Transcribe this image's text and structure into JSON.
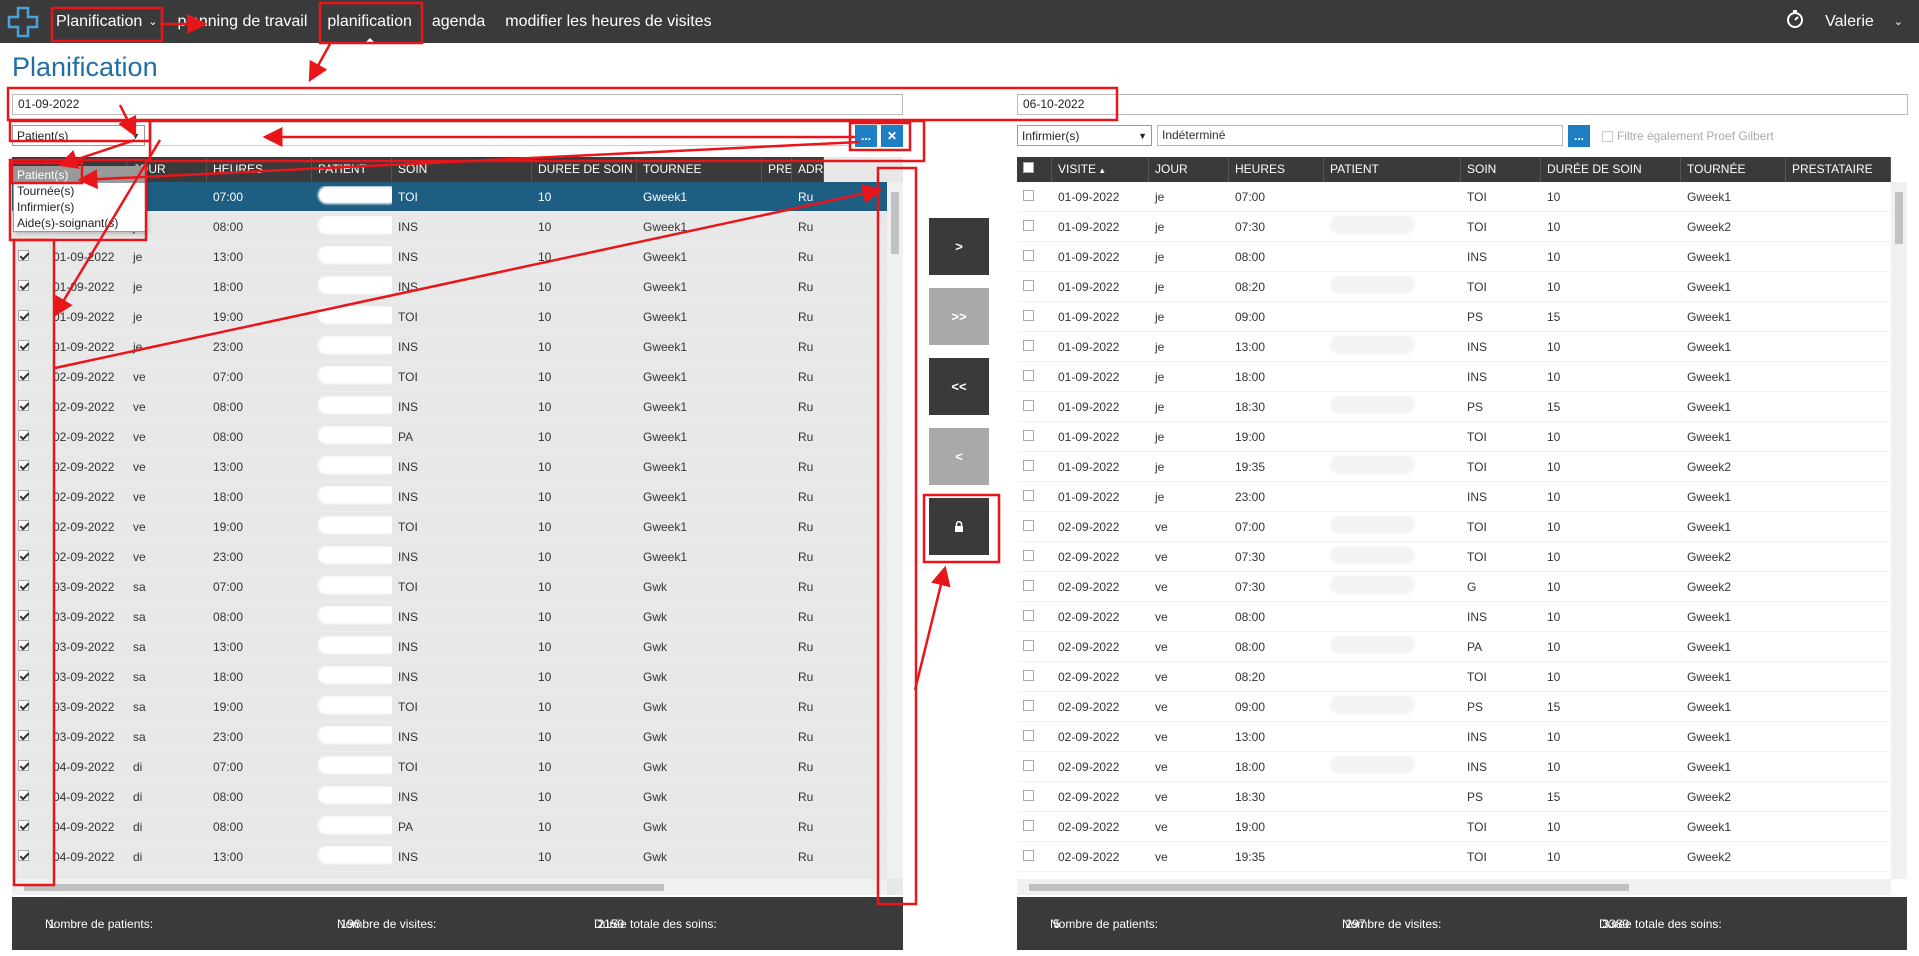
{
  "nav": {
    "items": [
      {
        "label": "Planification",
        "has_chevron": true
      },
      {
        "label": "planning de travail"
      },
      {
        "label": "planification",
        "active": true
      },
      {
        "label": "agenda"
      },
      {
        "label": "modifier les heures de visites"
      }
    ],
    "user": "Valerie",
    "timer_icon": "stopwatch-icon"
  },
  "page_title": "Planification",
  "date_from": "01-09-2022",
  "date_to": "06-10-2022",
  "left_panel": {
    "selector_value": "Patient(s)",
    "dropdown_options": [
      "Patient(s)",
      "Tournée(s)",
      "Infirmier(s)",
      "Aide(s)-soignant(s)"
    ],
    "browse_label": "...",
    "clear_label": "✕",
    "columns": [
      "JOUR",
      "HEURES",
      "PATIENT",
      "SOIN",
      "DUREE DE SOIN",
      "TOURNEE",
      "PRESTATAIRE",
      "ADR"
    ],
    "rows": [
      {
        "date": "01-09-2022",
        "jour": "je",
        "heure": "07:00",
        "soin": "TOI",
        "duree": "10",
        "tournee": "Gweek1",
        "adr": "Ru",
        "selected": true
      },
      {
        "date": "01-09-2022",
        "jour": "je",
        "heure": "08:00",
        "soin": "INS",
        "duree": "10",
        "tournee": "Gweek1",
        "adr": "Ru"
      },
      {
        "date": "01-09-2022",
        "jour": "je",
        "heure": "13:00",
        "soin": "INS",
        "duree": "10",
        "tournee": "Gweek1",
        "adr": "Ru"
      },
      {
        "date": "01-09-2022",
        "jour": "je",
        "heure": "18:00",
        "soin": "INS",
        "duree": "10",
        "tournee": "Gweek1",
        "adr": "Ru"
      },
      {
        "date": "01-09-2022",
        "jour": "je",
        "heure": "19:00",
        "soin": "TOI",
        "duree": "10",
        "tournee": "Gweek1",
        "adr": "Ru"
      },
      {
        "date": "01-09-2022",
        "jour": "je",
        "heure": "23:00",
        "soin": "INS",
        "duree": "10",
        "tournee": "Gweek1",
        "adr": "Ru"
      },
      {
        "date": "02-09-2022",
        "jour": "ve",
        "heure": "07:00",
        "soin": "TOI",
        "duree": "10",
        "tournee": "Gweek1",
        "adr": "Ru"
      },
      {
        "date": "02-09-2022",
        "jour": "ve",
        "heure": "08:00",
        "soin": "INS",
        "duree": "10",
        "tournee": "Gweek1",
        "adr": "Ru"
      },
      {
        "date": "02-09-2022",
        "jour": "ve",
        "heure": "08:00",
        "soin": "PA",
        "duree": "10",
        "tournee": "Gweek1",
        "adr": "Ru"
      },
      {
        "date": "02-09-2022",
        "jour": "ve",
        "heure": "13:00",
        "soin": "INS",
        "duree": "10",
        "tournee": "Gweek1",
        "adr": "Ru"
      },
      {
        "date": "02-09-2022",
        "jour": "ve",
        "heure": "18:00",
        "soin": "INS",
        "duree": "10",
        "tournee": "Gweek1",
        "adr": "Ru"
      },
      {
        "date": "02-09-2022",
        "jour": "ve",
        "heure": "19:00",
        "soin": "TOI",
        "duree": "10",
        "tournee": "Gweek1",
        "adr": "Ru"
      },
      {
        "date": "02-09-2022",
        "jour": "ve",
        "heure": "23:00",
        "soin": "INS",
        "duree": "10",
        "tournee": "Gweek1",
        "adr": "Ru"
      },
      {
        "date": "03-09-2022",
        "jour": "sa",
        "heure": "07:00",
        "soin": "TOI",
        "duree": "10",
        "tournee": "Gwk",
        "adr": "Ru"
      },
      {
        "date": "03-09-2022",
        "jour": "sa",
        "heure": "08:00",
        "soin": "INS",
        "duree": "10",
        "tournee": "Gwk",
        "adr": "Ru"
      },
      {
        "date": "03-09-2022",
        "jour": "sa",
        "heure": "13:00",
        "soin": "INS",
        "duree": "10",
        "tournee": "Gwk",
        "adr": "Ru"
      },
      {
        "date": "03-09-2022",
        "jour": "sa",
        "heure": "18:00",
        "soin": "INS",
        "duree": "10",
        "tournee": "Gwk",
        "adr": "Ru"
      },
      {
        "date": "03-09-2022",
        "jour": "sa",
        "heure": "19:00",
        "soin": "TOI",
        "duree": "10",
        "tournee": "Gwk",
        "adr": "Ru"
      },
      {
        "date": "03-09-2022",
        "jour": "sa",
        "heure": "23:00",
        "soin": "INS",
        "duree": "10",
        "tournee": "Gwk",
        "adr": "Ru"
      },
      {
        "date": "04-09-2022",
        "jour": "di",
        "heure": "07:00",
        "soin": "TOI",
        "duree": "10",
        "tournee": "Gwk",
        "adr": "Ru"
      },
      {
        "date": "04-09-2022",
        "jour": "di",
        "heure": "08:00",
        "soin": "INS",
        "duree": "10",
        "tournee": "Gwk",
        "adr": "Ru"
      },
      {
        "date": "04-09-2022",
        "jour": "di",
        "heure": "08:00",
        "soin": "PA",
        "duree": "10",
        "tournee": "Gwk",
        "adr": "Ru"
      },
      {
        "date": "04-09-2022",
        "jour": "di",
        "heure": "13:00",
        "soin": "INS",
        "duree": "10",
        "tournee": "Gwk",
        "adr": "Ru"
      }
    ],
    "footer": {
      "patients_label": "Nombre de patients:",
      "patients_value": "1",
      "visits_label": "Nombre de visites:",
      "visits_value": "196",
      "duration_label": "Durée totale des soins:",
      "duration_value": "2150"
    }
  },
  "middle_buttons": [
    {
      "label": ">",
      "style": "dark"
    },
    {
      "label": ">>",
      "style": "light"
    },
    {
      "label": "<<",
      "style": "dark"
    },
    {
      "label": "<",
      "style": "light"
    },
    {
      "label": "lock-icon",
      "style": "dark"
    }
  ],
  "right_panel": {
    "selector_value": "Infirmier(s)",
    "input_value": "Indéterminé",
    "browse_label": "...",
    "filter_label": "Filtre également Proef Gilbert",
    "columns": [
      "VISITE",
      "JOUR",
      "HEURES",
      "PATIENT",
      "SOIN",
      "DURÉE DE SOIN",
      "TOURNÉE",
      "PRESTATAIRE"
    ],
    "rows": [
      {
        "date": "01-09-2022",
        "jour": "je",
        "heure": "07:00",
        "blur": false,
        "soin": "TOI",
        "duree": "10",
        "tournee": "Gweek1"
      },
      {
        "date": "01-09-2022",
        "jour": "je",
        "heure": "07:30",
        "blur": true,
        "soin": "TOI",
        "duree": "10",
        "tournee": "Gweek2"
      },
      {
        "date": "01-09-2022",
        "jour": "je",
        "heure": "08:00",
        "blur": false,
        "soin": "INS",
        "duree": "10",
        "tournee": "Gweek1"
      },
      {
        "date": "01-09-2022",
        "jour": "je",
        "heure": "08:20",
        "blur": true,
        "soin": "TOI",
        "duree": "10",
        "tournee": "Gweek1"
      },
      {
        "date": "01-09-2022",
        "jour": "je",
        "heure": "09:00",
        "blur": false,
        "soin": "PS",
        "duree": "15",
        "tournee": "Gweek1"
      },
      {
        "date": "01-09-2022",
        "jour": "je",
        "heure": "13:00",
        "blur": true,
        "soin": "INS",
        "duree": "10",
        "tournee": "Gweek1"
      },
      {
        "date": "01-09-2022",
        "jour": "je",
        "heure": "18:00",
        "blur": false,
        "soin": "INS",
        "duree": "10",
        "tournee": "Gweek1"
      },
      {
        "date": "01-09-2022",
        "jour": "je",
        "heure": "18:30",
        "blur": true,
        "soin": "PS",
        "duree": "15",
        "tournee": "Gweek1"
      },
      {
        "date": "01-09-2022",
        "jour": "je",
        "heure": "19:00",
        "blur": false,
        "soin": "TOI",
        "duree": "10",
        "tournee": "Gweek1"
      },
      {
        "date": "01-09-2022",
        "jour": "je",
        "heure": "19:35",
        "blur": true,
        "soin": "TOI",
        "duree": "10",
        "tournee": "Gweek2"
      },
      {
        "date": "01-09-2022",
        "jour": "je",
        "heure": "23:00",
        "blur": false,
        "soin": "INS",
        "duree": "10",
        "tournee": "Gweek1"
      },
      {
        "date": "02-09-2022",
        "jour": "ve",
        "heure": "07:00",
        "blur": true,
        "soin": "TOI",
        "duree": "10",
        "tournee": "Gweek1"
      },
      {
        "date": "02-09-2022",
        "jour": "ve",
        "heure": "07:30",
        "blur": true,
        "soin": "TOI",
        "duree": "10",
        "tournee": "Gweek2"
      },
      {
        "date": "02-09-2022",
        "jour": "ve",
        "heure": "07:30",
        "blur": true,
        "soin": "G",
        "duree": "10",
        "tournee": "Gweek2"
      },
      {
        "date": "02-09-2022",
        "jour": "ve",
        "heure": "08:00",
        "blur": false,
        "soin": "INS",
        "duree": "10",
        "tournee": "Gweek1"
      },
      {
        "date": "02-09-2022",
        "jour": "ve",
        "heure": "08:00",
        "blur": true,
        "soin": "PA",
        "duree": "10",
        "tournee": "Gweek1"
      },
      {
        "date": "02-09-2022",
        "jour": "ve",
        "heure": "08:20",
        "blur": false,
        "soin": "TOI",
        "duree": "10",
        "tournee": "Gweek1"
      },
      {
        "date": "02-09-2022",
        "jour": "ve",
        "heure": "09:00",
        "blur": true,
        "soin": "PS",
        "duree": "15",
        "tournee": "Gweek1"
      },
      {
        "date": "02-09-2022",
        "jour": "ve",
        "heure": "13:00",
        "blur": false,
        "soin": "INS",
        "duree": "10",
        "tournee": "Gweek1"
      },
      {
        "date": "02-09-2022",
        "jour": "ve",
        "heure": "18:00",
        "blur": true,
        "soin": "INS",
        "duree": "10",
        "tournee": "Gweek1"
      },
      {
        "date": "02-09-2022",
        "jour": "ve",
        "heure": "18:30",
        "blur": false,
        "soin": "PS",
        "duree": "15",
        "tournee": "Gweek2"
      },
      {
        "date": "02-09-2022",
        "jour": "ve",
        "heure": "19:00",
        "blur": false,
        "soin": "TOI",
        "duree": "10",
        "tournee": "Gweek1"
      },
      {
        "date": "02-09-2022",
        "jour": "ve",
        "heure": "19:35",
        "blur": false,
        "soin": "TOI",
        "duree": "10",
        "tournee": "Gweek2"
      }
    ],
    "footer": {
      "patients_label": "Nombre de patients:",
      "patients_value": "5",
      "visits_label": "Nombre de visites:",
      "visits_value": "297",
      "duration_label": "Durée totale des soins:",
      "duration_value": "3380"
    }
  },
  "colors": {
    "nav_bg": "#3a3a3a",
    "title_blue": "#1f6fa5",
    "selected_row": "#1e5e82",
    "button_blue": "#1f7fc4",
    "annotation_red": "#e8161b"
  }
}
